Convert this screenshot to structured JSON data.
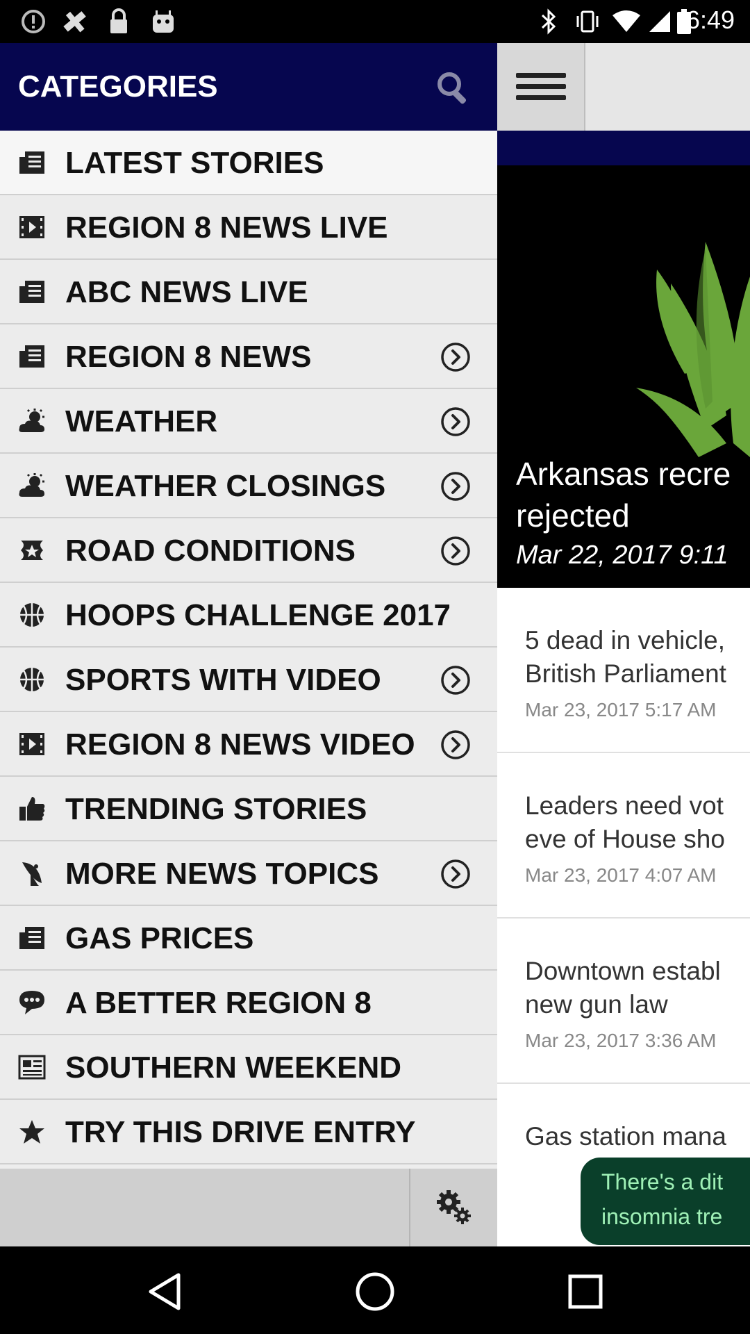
{
  "status_bar": {
    "time": "6:49",
    "icons": [
      "alert-circle-icon",
      "fake-gps-icon",
      "lock-icon",
      "android-icon",
      "bluetooth-icon",
      "vibrate-icon",
      "wifi-icon",
      "signal-icon",
      "battery-icon"
    ]
  },
  "drawer": {
    "title": "CATEGORIES",
    "items": [
      {
        "label": "LATEST STORIES",
        "icon": "newspaper-icon",
        "has_arrow": false
      },
      {
        "label": "REGION 8 NEWS LIVE",
        "icon": "film-icon",
        "has_arrow": false
      },
      {
        "label": "ABC NEWS LIVE",
        "icon": "newspaper-icon",
        "has_arrow": false
      },
      {
        "label": "REGION 8 NEWS",
        "icon": "newspaper-icon",
        "has_arrow": true
      },
      {
        "label": "WEATHER",
        "icon": "weather-icon",
        "has_arrow": true
      },
      {
        "label": "WEATHER CLOSINGS",
        "icon": "weather-icon",
        "has_arrow": true
      },
      {
        "label": "ROAD CONDITIONS",
        "icon": "road-sign-icon",
        "has_arrow": true
      },
      {
        "label": "HOOPS CHALLENGE 2017",
        "icon": "basketball-icon",
        "has_arrow": false
      },
      {
        "label": "SPORTS WITH VIDEO",
        "icon": "basketball-icon",
        "has_arrow": true
      },
      {
        "label": "REGION 8 NEWS VIDEO",
        "icon": "film-icon",
        "has_arrow": true
      },
      {
        "label": "TRENDING STORIES",
        "icon": "thumbs-up-icon",
        "has_arrow": false
      },
      {
        "label": "MORE NEWS TOPICS",
        "icon": "satellite-icon",
        "has_arrow": true
      },
      {
        "label": "GAS PRICES",
        "icon": "newspaper-icon",
        "has_arrow": false
      },
      {
        "label": "A BETTER REGION 8",
        "icon": "speech-bubble-icon",
        "has_arrow": false
      },
      {
        "label": "SOUTHERN WEEKEND",
        "icon": "document-icon",
        "has_arrow": false
      },
      {
        "label": "TRY THIS DRIVE ENTRY",
        "icon": "star-icon",
        "has_arrow": false
      }
    ]
  },
  "content": {
    "hero": {
      "title_line1": "Arkansas recre",
      "title_line2": "rejected",
      "date": "Mar 22, 2017 9:11"
    },
    "articles": [
      {
        "title_line1": "5 dead in vehicle,",
        "title_line2": "British Parliament",
        "date": "Mar 23, 2017 5:17 AM"
      },
      {
        "title_line1": "Leaders need vot",
        "title_line2": "eve of House sho",
        "date": "Mar 23, 2017 4:07 AM"
      },
      {
        "title_line1": "Downtown establ",
        "title_line2": "new gun law",
        "date": "Mar 23, 2017 3:36 AM"
      },
      {
        "title_line1": "Gas station mana",
        "title_line2": "",
        "date": ""
      }
    ],
    "ad": {
      "line1": "There's a dit",
      "line2": "insomnia tre"
    }
  },
  "colors": {
    "header_navy": "#06064f",
    "drawer_bg": "#ececec",
    "ad_green": "#0a3f2a"
  }
}
